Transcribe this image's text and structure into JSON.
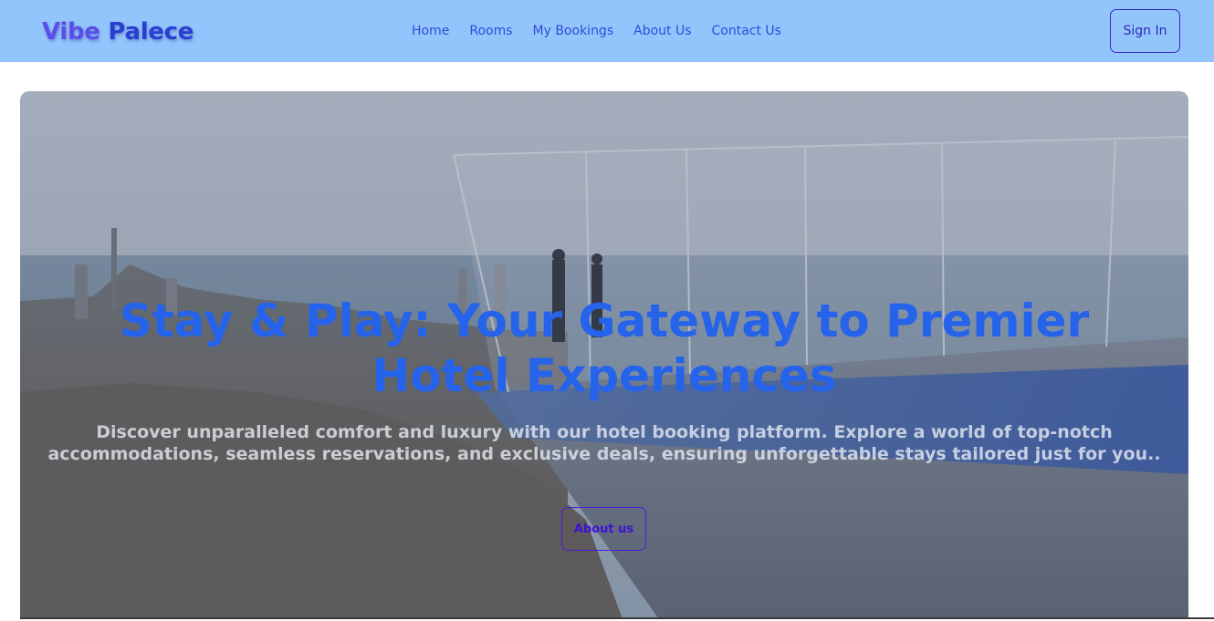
{
  "navbar": {
    "brand_first": "Vibe",
    "brand_second": "Palece",
    "links": [
      {
        "label": "Home"
      },
      {
        "label": "Rooms"
      },
      {
        "label": "My Bookings"
      },
      {
        "label": "About Us"
      },
      {
        "label": "Contact Us"
      }
    ],
    "signin_label": "Sign In"
  },
  "hero": {
    "title": "Stay & Play: Your Gateway to Premier Hotel Experiences",
    "description": "Discover unparalleled comfort and luxury with our hotel booking platform. Explore a world of top-notch accommodations, seamless reservations, and exclusive deals, ensuring unforgettable stays tailored just for you..",
    "button_label": "About us"
  },
  "colors": {
    "navbar_bg": "#93c5fd",
    "title": "#2563eb",
    "link": "#2f4bd6",
    "button_border": "#4a1fd8"
  }
}
